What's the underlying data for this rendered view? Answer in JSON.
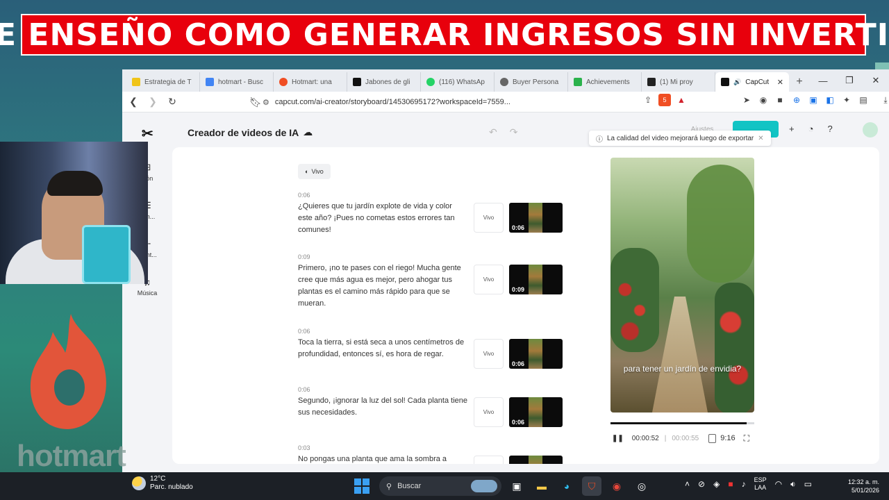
{
  "banner": {
    "text": "TE ENSEÑO COMO GENERAR INGRESOS SIN INVERTIR",
    "color": "#e8000c"
  },
  "browser": {
    "tabs": [
      {
        "label": "Estrategia de T",
        "favicon_color": "#f0c419",
        "active": false
      },
      {
        "label": "hotmart - Busc",
        "favicon_color": "#4285f4",
        "active": false
      },
      {
        "label": "Hotmart: una",
        "favicon_color": "#f04e23",
        "active": false
      },
      {
        "label": "Jabones de gli",
        "favicon_color": "#111111",
        "active": false
      },
      {
        "label": "(116) WhatsAp",
        "favicon_color": "#25d366",
        "active": false
      },
      {
        "label": "Buyer Persona",
        "favicon_color": "#666666",
        "active": false
      },
      {
        "label": "Achievements",
        "favicon_color": "#2bb24c",
        "active": false
      },
      {
        "label": "(1) Mi proy",
        "favicon_color": "#222222",
        "active": false
      },
      {
        "label": "CapCut",
        "favicon_color": "#111111",
        "active": true
      }
    ],
    "new_tab": "+",
    "window_controls": {
      "minimize": "—",
      "restore": "❐",
      "close": "✕"
    },
    "url": "capcut.com/ai-creator/storyboard/14530695172?workspaceId=7559...",
    "extensions_badge": "5"
  },
  "app": {
    "title": "Creador de videos de IA",
    "grey_button": "Ajustes",
    "toast": "La calidad del video mejorará luego de exportar",
    "sidebar": [
      {
        "label": "ción",
        "icon": "add-icon"
      },
      {
        "label": "gen...",
        "icon": "list-icon"
      },
      {
        "label": "ment...",
        "icon": "element-icon"
      },
      {
        "label": "Música",
        "icon": "music-icon"
      }
    ],
    "voice_chip": "Vivo",
    "scenes": [
      {
        "time": "0:06",
        "text": "¿Quieres que tu jardín explote de vida y color este año? ¡Pues no cometas estos errores tan comunes!",
        "voice": "Vivo",
        "thumb_duration": "0:06"
      },
      {
        "time": "0:09",
        "text": "Primero, ¡no te pases con el riego! Mucha gente cree que más agua es mejor, pero ahogar tus plantas es el camino más rápido para que se mueran.",
        "voice": "Vivo",
        "thumb_duration": "0:09"
      },
      {
        "time": "0:06",
        "text": "Toca la tierra, si está seca a unos centímetros de profundidad, entonces sí, es hora de regar.",
        "voice": "Vivo",
        "thumb_duration": "0:06"
      },
      {
        "time": "0:06",
        "text": "Segundo, ¡ignorar la luz del sol! Cada planta tiene sus necesidades.",
        "voice": "Vivo",
        "thumb_duration": "0:06"
      },
      {
        "time": "0:03",
        "text": "No pongas una planta que ama la sombra a",
        "voice": "",
        "thumb_duration": ""
      }
    ],
    "preview": {
      "subtitle": "para tener un jardín de envidia?",
      "progress_fraction": 0.945,
      "current_time": "00:00:52",
      "total_time": "00:00:55",
      "ratio": "9:16"
    }
  },
  "overlay": {
    "hotmart_text": "hotmart"
  },
  "taskbar": {
    "weather_temp": "12°C",
    "weather_desc": "Parc. nublado",
    "search_placeholder": "Buscar",
    "lang_1": "ESP",
    "lang_2": "LAA",
    "time": "12:32 a. m.",
    "date": "5/01/2026"
  }
}
